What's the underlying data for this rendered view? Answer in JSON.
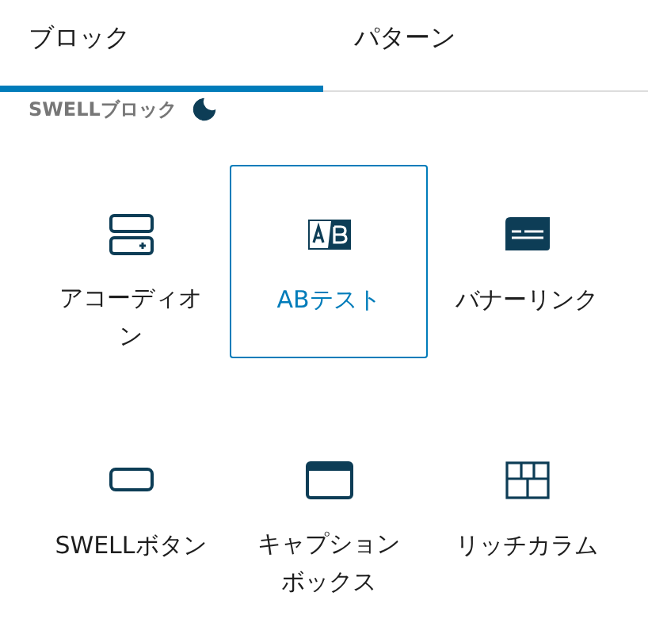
{
  "tabs": [
    {
      "label": "ブロック",
      "selected": true
    },
    {
      "label": "パターン",
      "selected": false
    }
  ],
  "section": {
    "title": "SWELLブロック"
  },
  "blocks": [
    {
      "label": "アコーディオン",
      "kind": "accordion",
      "selected": false
    },
    {
      "label": "ABテスト",
      "kind": "abtest",
      "selected": true
    },
    {
      "label": "バナーリンク",
      "kind": "banner",
      "selected": false
    },
    {
      "label": "SWELLボタン",
      "kind": "button",
      "selected": false
    },
    {
      "label": "キャプションボックス",
      "kind": "caption",
      "selected": false
    },
    {
      "label": "リッチカラム",
      "kind": "columns",
      "selected": false
    }
  ]
}
